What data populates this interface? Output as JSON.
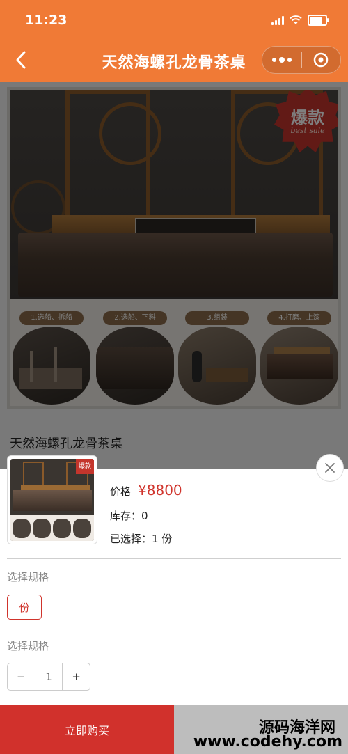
{
  "status_bar": {
    "time": "11:23"
  },
  "nav": {
    "title": "天然海螺孔龙骨茶桌",
    "back_icon": "chevron-left-icon",
    "menu_icon": "more-dots-icon",
    "close_icon": "target-circle-icon"
  },
  "product": {
    "name": "天然海螺孔龙骨茶桌",
    "image_badge": {
      "title": "爆款",
      "subtitle": "best sale"
    },
    "steps": [
      "1.选船、拆船",
      "2.选船、下料",
      "3.组装",
      "4.打磨、上漆"
    ]
  },
  "sheet": {
    "thumb_badge": "爆款",
    "price_label": "价格",
    "price_value": "¥8800",
    "stock": "库存：0",
    "selected": "已选择：1 份",
    "spec_label_1": "选择规格",
    "spec_option": "份",
    "spec_label_2": "选择规格",
    "quantity": "1",
    "minus": "−",
    "plus": "+"
  },
  "footer": {
    "buy_now": "立即购买",
    "watermark_1": "源码海洋网",
    "watermark_2": "www.codehy.com"
  },
  "colors": {
    "header": "#f07a36",
    "accent_red": "#d1312c",
    "price_red": "#d0342c"
  }
}
